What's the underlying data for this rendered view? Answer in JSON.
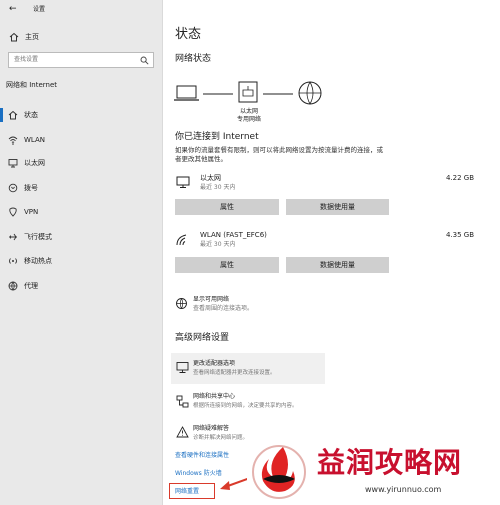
{
  "window": {
    "back_glyph": "←",
    "title": "设置"
  },
  "sidebar": {
    "home": "主页",
    "search_placeholder": "查找设置",
    "section": "网络和 Internet",
    "items": [
      {
        "label": "状态",
        "icon": "home-icon"
      },
      {
        "label": "WLAN",
        "icon": "wifi-icon"
      },
      {
        "label": "以太网",
        "icon": "monitor-icon"
      },
      {
        "label": "拨号",
        "icon": "dialup-icon"
      },
      {
        "label": "VPN",
        "icon": "vpn-icon"
      },
      {
        "label": "飞行模式",
        "icon": "airplane-icon"
      },
      {
        "label": "移动热点",
        "icon": "hotspot-icon"
      },
      {
        "label": "代理",
        "icon": "globe-icon"
      }
    ]
  },
  "main": {
    "title": "状态",
    "network_status": "网络状态",
    "diagram_label_1": "以太网",
    "diagram_label_2": "专用网络",
    "connected_title": "你已连接到 Internet",
    "description": "如果你的流量套餐有限制，则可以将此网络设置为按流量计费的连接，或者更改其他属性。",
    "connections": [
      {
        "name": "以太网",
        "time": "最近 30 天内",
        "usage": "4.22 GB",
        "btn1": "属性",
        "btn2": "数据使用量"
      },
      {
        "name": "WLAN (FAST_EFC6)",
        "time": "最近 30 天内",
        "usage": "4.35 GB",
        "btn1": "属性",
        "btn2": "数据使用量"
      }
    ],
    "show_networks_title": "显示可用网络",
    "show_networks_desc": "查看周围的连接选项。",
    "advanced_title": "高级网络设置",
    "adv_items": [
      {
        "title": "更改适配器选项",
        "desc": "查看网络适配器并更改连接设置。"
      },
      {
        "title": "网络和共享中心",
        "desc": "根据所连接到的网络，决定要共享的内容。"
      },
      {
        "title": "网络疑难解答",
        "desc": "诊断并解决网络问题。"
      }
    ],
    "link_hardware": "查看硬件和连接属性",
    "link_firewall": "Windows 防火墙",
    "link_reset": "网络重置"
  },
  "watermark": {
    "text": "益润攻略网",
    "url": "www.yirunnuo.com"
  },
  "colors": {
    "accent": "#1a6fc2",
    "annotation": "#d93a2b",
    "watermark_red": "#c8102e"
  }
}
